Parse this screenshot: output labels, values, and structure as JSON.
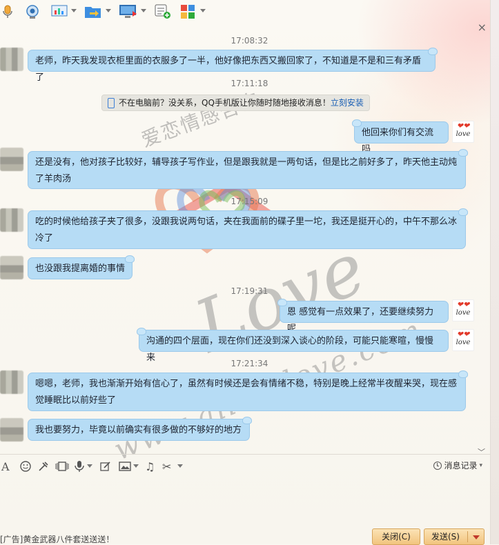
{
  "toolbar": {
    "icons": [
      "microphone-icon",
      "video-camera-icon",
      "screen-share-icon",
      "file-transfer-icon",
      "remote-desktop-icon",
      "create-group-icon",
      "apps-icon"
    ]
  },
  "messages": [
    {
      "time": "17:08:32"
    },
    {
      "side": "left",
      "text": "老师，昨天我发现衣柜里面的衣服多了一半，他好像把东西又搬回家了，不知道是不是和三有矛盾了"
    },
    {
      "time": "17:11:18"
    },
    {
      "side": "right",
      "text": "他回来你们有交流吗"
    },
    {
      "side": "left",
      "text": "还是没有，他对孩子比较好，辅导孩子写作业，但是跟我就是一两句话，但是比之前好多了，昨天他主动炖了羊肉汤"
    },
    {
      "time": "17:15:09"
    },
    {
      "side": "left",
      "text": "吃的时候他给孩子夹了很多，没跟我说两句话，夹在我面前的碟子里一坨，我还是挺开心的，中午不那么冰冷了"
    },
    {
      "side": "left",
      "text": "也没跟我提离婚的事情"
    },
    {
      "time": "17:19:31"
    },
    {
      "side": "right",
      "text": "恩 感觉有一点效果了，还要继续努力呢"
    },
    {
      "side": "right",
      "text": "沟通的四个层面，现在你们还没到深入谈心的阶段，可能只能寒暄，慢慢来"
    },
    {
      "time": "17:21:34"
    },
    {
      "side": "left",
      "text": "嗯嗯，老师，我也渐渐开始有信心了，虽然有时候还是会有情绪不稳，特别是晚上经常半夜醒来哭，现在感觉睡眠比以前好些了"
    },
    {
      "side": "left",
      "text": "我也要努力，毕竟以前确实有很多做的不够好的地方"
    }
  ],
  "notice": {
    "text": "不在电脑前？没关系，QQ手机版让你随时随地接收消息！",
    "link": "立刻安装"
  },
  "watermark": {
    "cn": "爱恋情感咨询",
    "love": "Love",
    "url": "www.ailianlove.com"
  },
  "love_avatar": {
    "word": "love"
  },
  "bottom": {
    "history_label": "消息记录",
    "ad_text": "[广告]黄金武器八件套送送送！",
    "close_label": "关闭(C)",
    "send_label": "发送(S)"
  },
  "colors": {
    "bubble": "#b6dcf5",
    "button": "#f2c47e"
  }
}
